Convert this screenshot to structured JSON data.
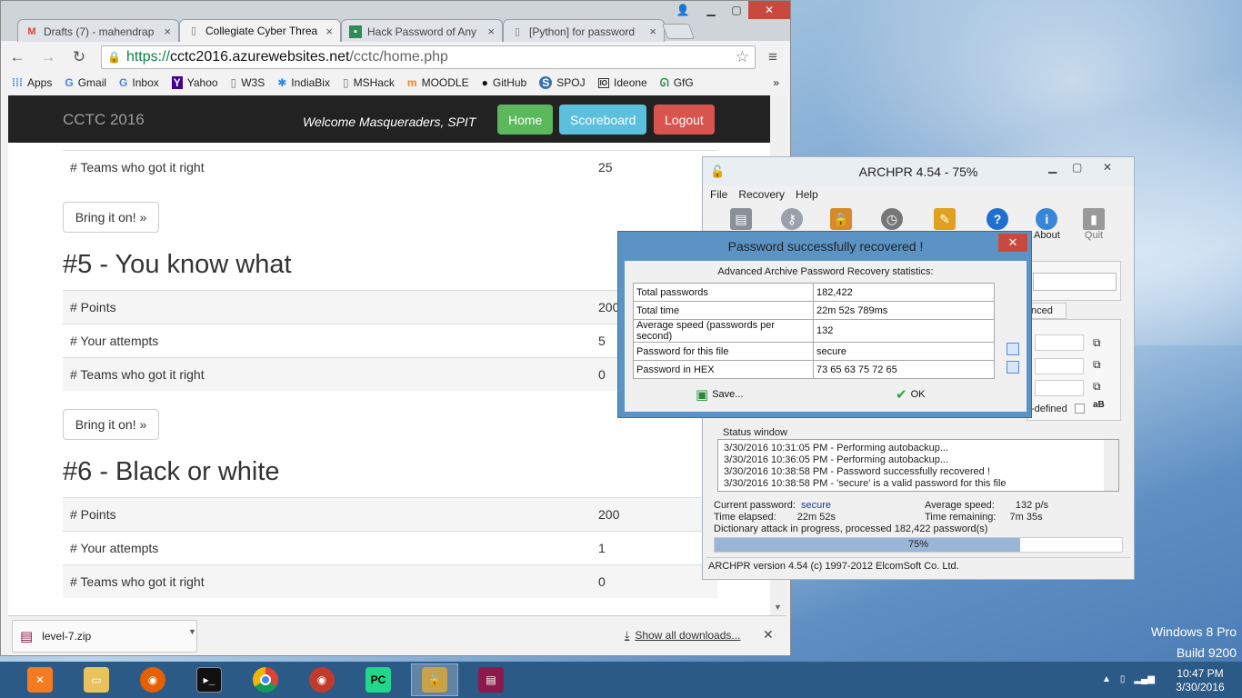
{
  "desktop": {
    "os_line1": "Windows 8 Pro",
    "os_line2": "Build 9200"
  },
  "chrome": {
    "tabs": [
      {
        "title": "Drafts (7) - mahendrap",
        "icon": "gmail-icon",
        "close": "×"
      },
      {
        "title": "Collegiate Cyber Threa",
        "icon": "page-icon",
        "close": "×"
      },
      {
        "title": "Hack Password of Any",
        "icon": "green-site-icon",
        "close": "×"
      },
      {
        "title": "[Python] for password",
        "icon": "page-icon",
        "close": "×"
      }
    ],
    "url": {
      "proto": "https://",
      "host": "cctc2016.azurewebsites.net",
      "path": "/cctc/home.php"
    },
    "bookmarks": [
      "Apps",
      "Gmail",
      "Inbox",
      "Yahoo",
      "W3S",
      "IndiaBix",
      "MSHack",
      "MOODLE",
      "GitHub",
      "SPOJ",
      "Ideone",
      "GfG"
    ],
    "downloads": {
      "file": "level-7.zip",
      "show_all": "Show all downloads..."
    }
  },
  "site": {
    "brand": "CCTC 2016",
    "welcome": "Welcome Masqueraders, SPIT",
    "nav": {
      "home": "Home",
      "scoreboard": "Scoreboard",
      "logout": "Logout"
    },
    "colors": {
      "home": "#5cb85c",
      "scoreboard": "#5bc0de",
      "logout": "#d9534f"
    },
    "bring_label": "Bring it on! »",
    "prev_challenge": {
      "teams_label": "# Teams who got it right",
      "teams": "25"
    },
    "challenges": [
      {
        "title": "#5 - You know what",
        "points_label": "# Points",
        "points": "200",
        "attempts_label": "# Your attempts",
        "attempts": "5",
        "teams_label": "# Teams who got it right",
        "teams": "0"
      },
      {
        "title": "#6 - Black or white",
        "points_label": "# Points",
        "points": "200",
        "attempts_label": "# Your attempts",
        "attempts": "1",
        "teams_label": "# Teams who got it right",
        "teams": "0"
      }
    ]
  },
  "archpr": {
    "title": "ARCHPR 4.54 - 75%",
    "menu": [
      "File",
      "Recovery",
      "Help"
    ],
    "tools": {
      "about": "About",
      "quit": "Quit"
    },
    "partial": {
      "tab": "nced",
      "userdef": "-defined"
    },
    "status_label": "Status window",
    "log": [
      "3/30/2016 10:31:05 PM - Performing autobackup...",
      "3/30/2016 10:36:05 PM - Performing autobackup...",
      "3/30/2016 10:38:58 PM - Password successfully recovered !",
      "3/30/2016 10:38:58 PM - 'secure' is a valid password for this file"
    ],
    "current_password_label": "Current password:",
    "current_password": "secure",
    "average_speed_label": "Average speed:",
    "average_speed": "132 p/s",
    "time_elapsed_label": "Time elapsed:",
    "time_elapsed": "22m 52s",
    "time_remaining_label": "Time remaining:",
    "time_remaining": "7m 35s",
    "progress_text": "Dictionary attack in progress, processed 182,422 password(s)",
    "progress_value": 0.75,
    "progress_label": "75%",
    "statusbar": "ARCHPR version 4.54 (c) 1997-2012 ElcomSoft Co. Ltd."
  },
  "dialog": {
    "title": "Password successfully recovered !",
    "heading": "Advanced Archive Password Recovery statistics:",
    "rows": [
      {
        "label": "Total passwords",
        "value": "182,422"
      },
      {
        "label": "Total time",
        "value": "22m 52s 789ms"
      },
      {
        "label": "Average speed (passwords per second)",
        "value": "132"
      },
      {
        "label": "Password for this file",
        "value": "secure"
      },
      {
        "label": "Password in HEX",
        "value": "73 65 63 75 72 65"
      }
    ],
    "save": "Save...",
    "ok": "OK"
  },
  "taskbar": {
    "time": "10:47 PM",
    "date": "3/30/2016"
  }
}
